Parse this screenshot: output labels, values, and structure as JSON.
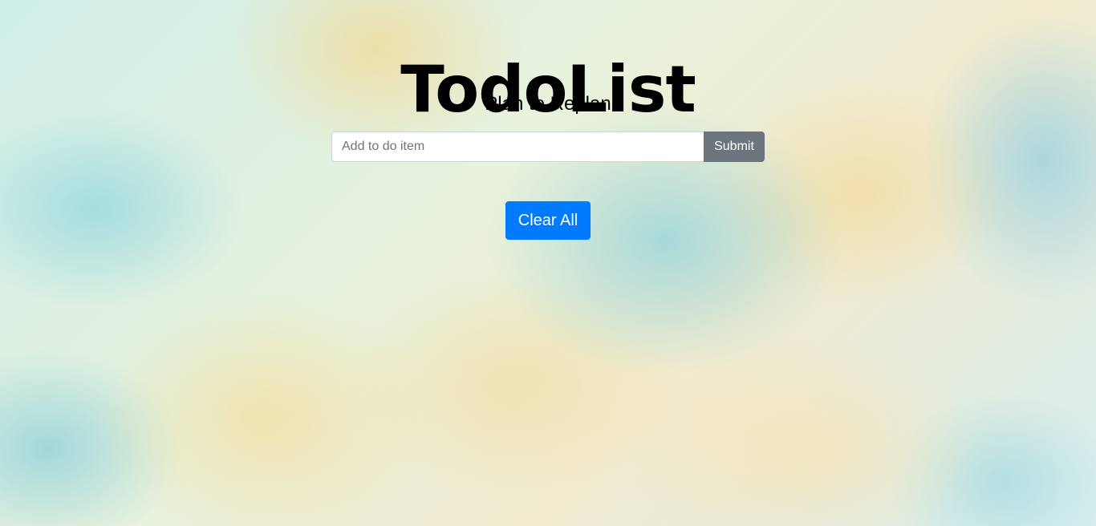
{
  "header": {
    "title": "TodoList",
    "subtitle": "Plan to Replan"
  },
  "form": {
    "input_value": "",
    "input_placeholder": "Add to do item",
    "submit_label": "Submit"
  },
  "todo_items": [],
  "actions": {
    "clear_all_label": "Clear All"
  },
  "colors": {
    "primary_button": "#007bff",
    "secondary_button": "#6c757d",
    "title_text": "#000000"
  }
}
